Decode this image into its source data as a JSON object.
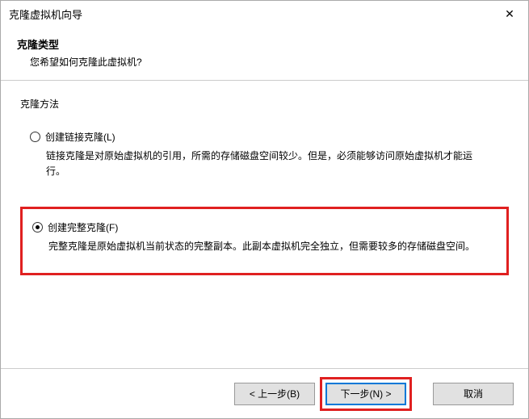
{
  "titlebar": {
    "title": "克隆虚拟机向导",
    "close_icon": "✕"
  },
  "header": {
    "title": "克隆类型",
    "subtitle": "您希望如何克隆此虚拟机?"
  },
  "body": {
    "section_label": "克隆方法",
    "options": [
      {
        "label": "创建链接克隆(L)",
        "checked": false,
        "desc": "链接克隆是对原始虚拟机的引用，所需的存储磁盘空间较少。但是，必须能够访问原始虚拟机才能运行。"
      },
      {
        "label": "创建完整克隆(F)",
        "checked": true,
        "desc": "完整克隆是原始虚拟机当前状态的完整副本。此副本虚拟机完全独立，但需要较多的存储磁盘空间。"
      }
    ]
  },
  "footer": {
    "back": "< 上一步(B)",
    "next": "下一步(N) >",
    "cancel": "取消"
  }
}
